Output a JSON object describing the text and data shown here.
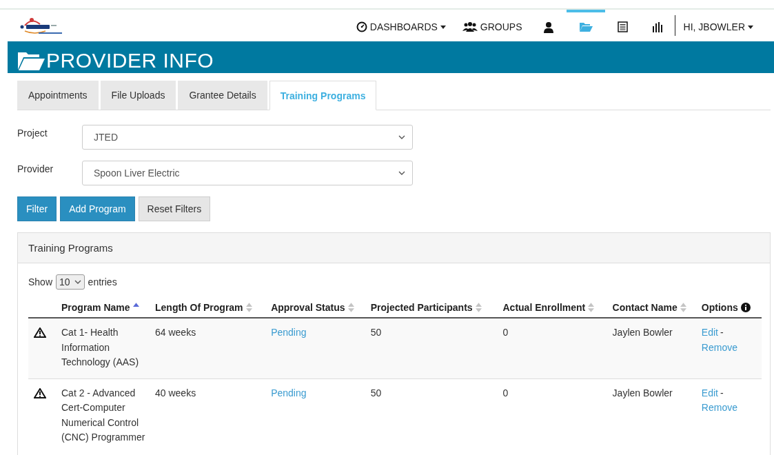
{
  "nav": [
    {
      "kind": "menu",
      "label": "DASHBOARDS",
      "selected": false
    },
    {
      "kind": "link",
      "label": "GROUPS",
      "selected": false
    },
    {
      "kind": "icon",
      "selected": false
    },
    {
      "kind": "icon",
      "selected": true
    },
    {
      "kind": "icon",
      "selected": false
    },
    {
      "kind": "icon",
      "selected": false
    },
    {
      "kind": "user",
      "label": "HI, JBOWLER",
      "selected": false
    }
  ],
  "page_title": "PROVIDER INFO",
  "tabs": [
    {
      "label": "Appointments",
      "selected": false
    },
    {
      "label": "File Uploads",
      "selected": false
    },
    {
      "label": "Grantee Details",
      "selected": false
    },
    {
      "label": "Training Programs",
      "selected": true
    }
  ],
  "filters": [
    {
      "label": "Project",
      "value": "JTED"
    },
    {
      "label": "Provider",
      "value": "Spoon Liver Electric"
    }
  ],
  "buttons": [
    {
      "label": "Filter",
      "kind": "primary"
    },
    {
      "label": "Add Program",
      "kind": "primary"
    },
    {
      "label": "Reset Filters",
      "kind": "default"
    }
  ],
  "panel": {
    "title": "Training Programs",
    "show_label": "Show",
    "page_size": "10",
    "entries_label": "entries",
    "columns": [
      {
        "kind": "sortable",
        "label": "Program Name",
        "sorted": true
      },
      {
        "kind": "sortable",
        "label": "Length Of Program",
        "sorted": false
      },
      {
        "kind": "sortable",
        "label": "Approval Status",
        "sorted": false
      },
      {
        "kind": "sortable",
        "label": "Projected Participants",
        "sorted": false
      },
      {
        "kind": "sortable",
        "label": "Actual Enrollment",
        "sorted": false
      },
      {
        "kind": "sortable",
        "label": "Contact Name",
        "sorted": false
      },
      {
        "kind": "info",
        "label": "Options"
      }
    ],
    "rows": [
      {
        "warning": true,
        "name": "Cat 1- Health Information Technology (AAS)",
        "length": "64 weeks",
        "status": "Pending",
        "projected": "50",
        "actual": "0",
        "contact": "Jaylen Bowler",
        "edit": "Edit",
        "separator": "-",
        "remove": "Remove"
      },
      {
        "warning": true,
        "name": "Cat 2 - Advanced Cert-Computer Numerical Control (CNC) Programmer",
        "length": "40 weeks",
        "status": "Pending",
        "projected": "50",
        "actual": "0",
        "contact": "Jaylen Bowler",
        "edit": "Edit",
        "separator": "-",
        "remove": "Remove"
      }
    ]
  }
}
